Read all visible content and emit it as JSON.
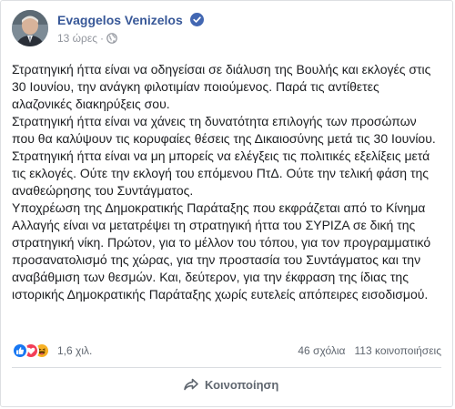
{
  "post": {
    "author": "Evaggelos Venizelos",
    "verified": true,
    "time": "13 ώρες",
    "privacy_icon": "globe-icon",
    "paragraphs": [
      "Στρατηγική ήττα είναι να οδηγείσαι σε διάλυση της Βουλής και εκλογές στις 30 Ιουνίου, την ανάγκη φιλοτιμίαν ποιούμενος. Παρά τις αντίθετες αλαζονικές διακηρύξεις σου.",
      "Στρατηγική ήττα είναι να χάνεις τη δυνατότητα επιλογής των προσώπων που θα καλύψουν τις κορυφαίες θέσεις της Δικαιοσύνης μετά τις 30 Ιουνίου.",
      "Στρατηγική ήττα είναι να μη μπορείς να ελέγξεις τις πολιτικές εξελίξεις μετά τις εκλογές. Ούτε την εκλογή του επόμενου ΠτΔ. Ούτε την τελική φάση της αναθεώρησης του Συντάγματος.",
      "Υποχρέωση της Δημοκρατικής Παράταξης που εκφράζεται από το Κίνημα Αλλαγής είναι να μετατρέψει τη στρατηγική ήττα του ΣΥΡΙΖΑ σε δική της στρατηγική νίκη. Πρώτον, για το μέλλον του τόπου, για τον προγραμματικό προσανατολισμό της χώρας, για την προστασία του Συντάγματος και την αναβάθμιση των θεσμών. Και, δεύτερον, για την έκφραση της ίδιας της ιστορικής Δημοκρατικής Παράταξης χωρίς ευτελείς απόπειρες εισοδισμού."
    ]
  },
  "reactions": {
    "icons": [
      "like-icon",
      "love-icon",
      "haha-icon"
    ],
    "count": "1,6 χιλ.",
    "comments": "46 σχόλια",
    "shares": "113 κοινοποιήσεις"
  },
  "actions": {
    "share_label": "Κοινοποίηση"
  },
  "colors": {
    "author": "#385898",
    "meta": "#90949c",
    "like": "#1877f2",
    "love": "#f33e58",
    "haha": "#f7b125"
  }
}
